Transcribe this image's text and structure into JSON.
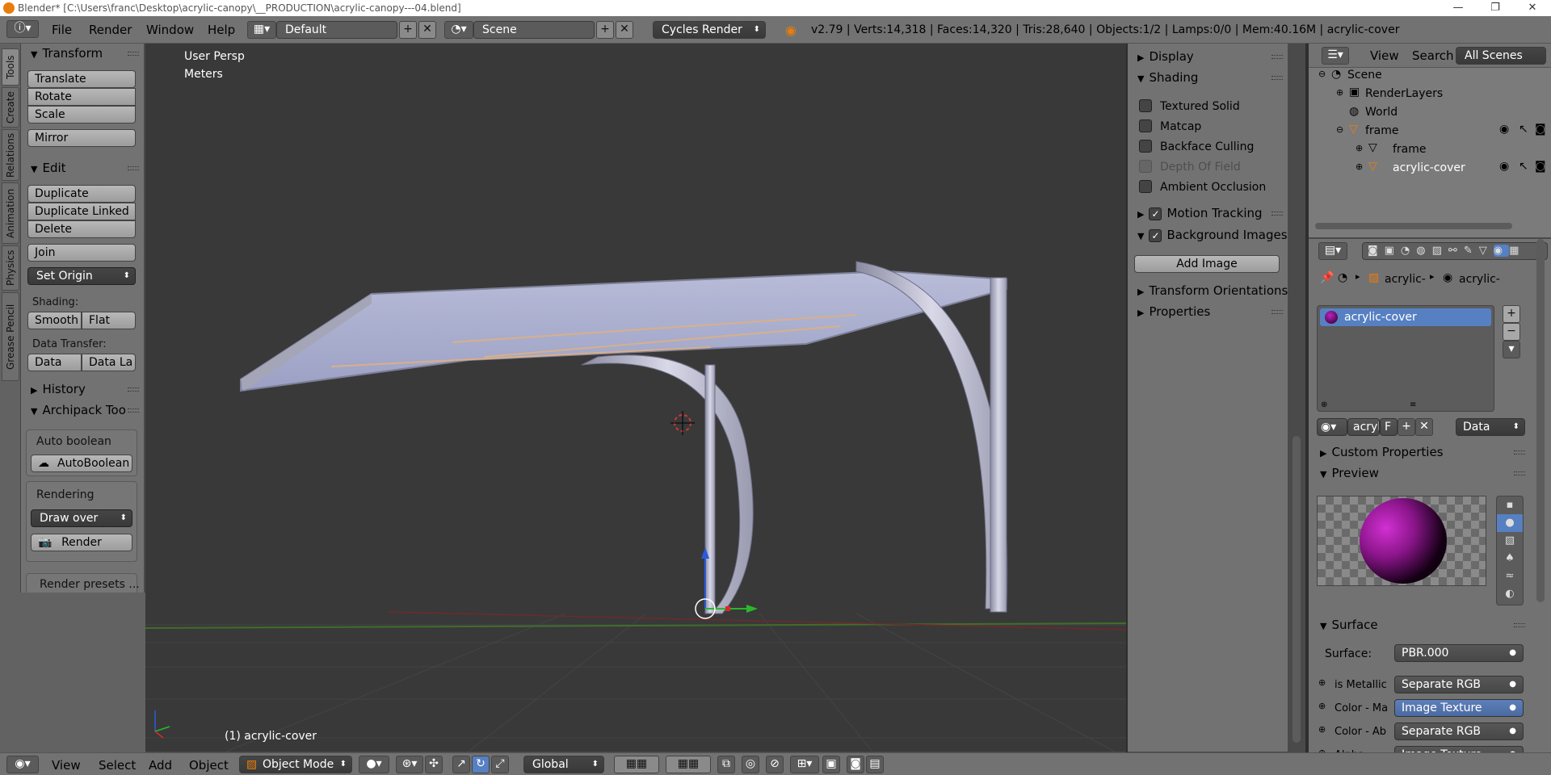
{
  "window": {
    "title": "Blender* [C:\\Users\\franc\\Desktop\\acrylic-canopy\\__PRODUCTION\\acrylic-canopy---04.blend]"
  },
  "menubar": {
    "menus": [
      "File",
      "Render",
      "Window",
      "Help"
    ],
    "layout": "Default",
    "scene": "Scene",
    "engine": "Cycles Render",
    "stats": "v2.79 | Verts:14,318 | Faces:14,320 | Tris:28,640 | Objects:1/2 | Lamps:0/0 | Mem:40.16M | acrylic-cover"
  },
  "left_tabs": [
    "Tools",
    "Create",
    "Relations",
    "Animation",
    "Physics",
    "Grease Pencil"
  ],
  "toolshelf": {
    "transform": {
      "title": "Transform",
      "buttons": [
        "Translate",
        "Rotate",
        "Scale",
        "Mirror"
      ]
    },
    "edit": {
      "title": "Edit",
      "buttons": [
        "Duplicate",
        "Duplicate Linked",
        "Delete",
        "Join"
      ],
      "set_origin": "Set Origin",
      "shading_label": "Shading:",
      "smooth": "Smooth",
      "flat": "Flat",
      "data_transfer_label": "Data Transfer:",
      "data": "Data",
      "data_la": "Data La"
    },
    "history": "History",
    "archipack": {
      "title": "Archipack Too",
      "auto_boolean_label": "Auto boolean",
      "auto_boolean_btn": "AutoBoolean",
      "rendering_label": "Rendering",
      "draw_over": "Draw over",
      "render_btn": "Render",
      "render_presets": "Render presets ..."
    }
  },
  "viewport": {
    "view_name": "User Persp",
    "units": "Meters",
    "object_label": "(1) acrylic-cover"
  },
  "npanel": {
    "display": "Display",
    "shading": "Shading",
    "shading_options": [
      {
        "label": "Textured Solid",
        "disabled": false
      },
      {
        "label": "Matcap",
        "disabled": false
      },
      {
        "label": "Backface Culling",
        "disabled": false
      },
      {
        "label": "Depth Of Field",
        "disabled": true
      },
      {
        "label": "Ambient Occlusion",
        "disabled": false
      }
    ],
    "motion_tracking": "Motion Tracking",
    "background_images": "Background Images",
    "add_image": "Add Image",
    "transform_orientations": "Transform Orientations",
    "properties": "Properties"
  },
  "outliner": {
    "view": "View",
    "search": "Search",
    "all_scenes": "All Scenes",
    "items": [
      "Scene",
      "RenderLayers",
      "World",
      "frame",
      "frame",
      "acrylic-cover"
    ]
  },
  "properties": {
    "crumb1": "acrylic-",
    "crumb2": "acrylic-",
    "material_slot": "acrylic-cover",
    "mat_name": "acryli",
    "mat_f": "F",
    "link": "Data",
    "custom_properties": "Custom Properties",
    "preview": "Preview",
    "surface_panel": "Surface",
    "surface_label": "Surface:",
    "surface_value": "PBR.000",
    "inputs": [
      {
        "label": "is Metallic",
        "value": "Separate RGB",
        "highlight": false
      },
      {
        "label": "Color - Ma",
        "value": "Image Texture",
        "highlight": true
      },
      {
        "label": "Color - Ab",
        "value": "Separate RGB",
        "highlight": false
      },
      {
        "label": "Alpha:",
        "value": "Image Texture",
        "highlight": false
      }
    ]
  },
  "bottombar": {
    "menus": [
      "View",
      "Select",
      "Add",
      "Object"
    ],
    "mode": "Object Mode",
    "orientation": "Global"
  },
  "colors": {
    "panel_bg": "#727272",
    "viewport_bg": "#393939",
    "selected_blue": "#5680c2",
    "accent_orange": "#e87d0d"
  }
}
